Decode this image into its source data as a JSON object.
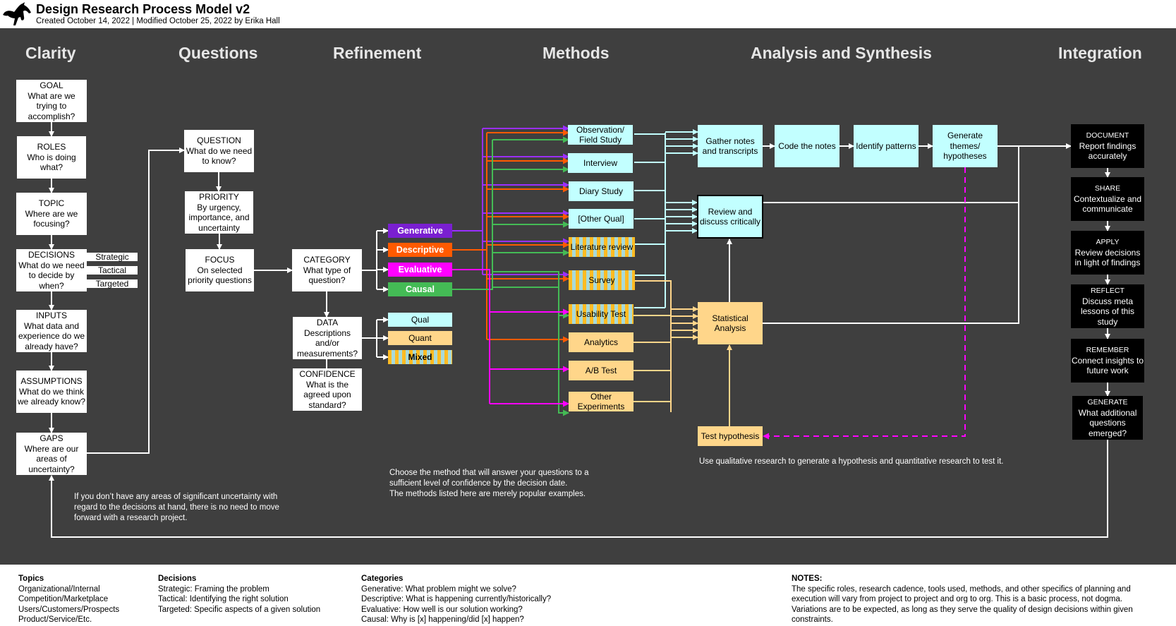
{
  "header": {
    "title": "Design Research Process Model v2",
    "subtitle": "Created October 14, 2022 | Modified October 25, 2022 by Erika Hall",
    "logo_icon": "kicking-horse-logo"
  },
  "stages": [
    "Clarity",
    "Questions",
    "Refinement",
    "Methods",
    "Analysis and Synthesis",
    "Integration"
  ],
  "clarity": [
    {
      "label": "GOAL",
      "text": "What are we trying to accomplish?"
    },
    {
      "label": "ROLES",
      "text": "Who is doing what?"
    },
    {
      "label": "TOPIC",
      "text": "Where are we focusing?"
    },
    {
      "label": "DECISIONS",
      "text": "What do we need to decide by when?"
    },
    {
      "label": "INPUTS",
      "text": "What data and experience do we already have?"
    },
    {
      "label": "ASSUMPTIONS",
      "text": "What do we think we already know?"
    },
    {
      "label": "GAPS",
      "text": "Where are our areas of uncertainty?"
    }
  ],
  "decision_tags": [
    "Strategic",
    "Tactical",
    "Targeted"
  ],
  "questions": [
    {
      "label": "QUESTION",
      "text": "What do we need to know?"
    },
    {
      "label": "PRIORITY",
      "text": "By urgency, importance, and uncertainty"
    },
    {
      "label": "FOCUS",
      "text": "On selected priority questions"
    }
  ],
  "refinement": [
    {
      "label": "CATEGORY",
      "text": "What type of question?"
    },
    {
      "label": "DATA",
      "text": "Descriptions and/or measurements?"
    },
    {
      "label": "CONFIDENCE",
      "text": "What is the agreed upon standard?"
    }
  ],
  "categories": [
    {
      "label": "Generative",
      "color": "#7a1fd1"
    },
    {
      "label": "Descriptive",
      "color": "#ff5a00"
    },
    {
      "label": "Evaluative",
      "color": "#ff00ff"
    },
    {
      "label": "Causal",
      "color": "#44bb55"
    }
  ],
  "data_types": [
    {
      "label": "Qual",
      "style": "cyan"
    },
    {
      "label": "Quant",
      "style": "peach"
    },
    {
      "label": "Mixed",
      "style": "stripe"
    }
  ],
  "methods": [
    {
      "label": "Observation/ Field Study",
      "style": "cyan"
    },
    {
      "label": "Interview",
      "style": "cyan"
    },
    {
      "label": "Diary Study",
      "style": "cyan"
    },
    {
      "label": "[Other Qual]",
      "style": "cyan"
    },
    {
      "label": "Literature review",
      "style": "stripe"
    },
    {
      "label": "Survey",
      "style": "stripe"
    },
    {
      "label": "Usability Test",
      "style": "stripe"
    },
    {
      "label": "Analytics",
      "style": "peach"
    },
    {
      "label": "A/B Test",
      "style": "peach"
    },
    {
      "label": "Other Experiments",
      "style": "peach"
    }
  ],
  "analysis": {
    "gather": "Gather notes and transcripts",
    "code": "Code the notes",
    "identify": "Identify patterns",
    "generate": "Generate themes/ hypotheses",
    "review": "Review and discuss critically",
    "statistical": "Statistical Analysis",
    "test": "Test hypothesis"
  },
  "integration": [
    {
      "label": "DOCUMENT",
      "text": "Report findings accurately"
    },
    {
      "label": "SHARE",
      "text": "Contextualize and communicate"
    },
    {
      "label": "APPLY",
      "text": "Review decisions in light of findings"
    },
    {
      "label": "REFLECT",
      "text": "Discuss meta lessons of this study"
    },
    {
      "label": "REMEMBER",
      "text": "Connect insights to future work"
    },
    {
      "label": "GENERATE",
      "text": "What additional questions emerged?"
    }
  ],
  "notes": {
    "gaps_note": "If you don’t have any areas of significant uncertainty with regard to the decisions at hand, there is no need to move forward with a research project.",
    "methods_note_1": "Choose the method that will answer your questions to a",
    "methods_note_2": "sufficient level of confidence by the decision date.",
    "methods_note_3": "The methods listed here are merely popular examples.",
    "hypothesis_note": "Use qualitative research to generate a hypothesis and quantitative research to test it."
  },
  "legend": {
    "topics": {
      "title": "Topics",
      "items": [
        "Organizational/Internal",
        "Competition/Marketplace",
        "Users/Customers/Prospects",
        "Product/Service/Etc."
      ]
    },
    "decisions": {
      "title": "Decisions",
      "items": [
        "Strategic: Framing the problem",
        "Tactical: Identifying the right solution",
        "Targeted: Specific aspects of a given solution"
      ]
    },
    "categories": {
      "title": "Categories",
      "items": [
        "Generative: What problem might we solve?",
        "Descriptive: What is happening currently/historically?",
        "Evaluative: How well is our solution working?",
        "Causal: Why is [x] happening/did [x] happen?"
      ]
    },
    "notes": {
      "title": "NOTES:",
      "text": "The specific roles, research cadence, tools used, methods, and other specifics of planning and execution will vary from project to project and org to org. This is a basic process, not dogma. Variations are to be expected, as long as they serve the quality of design decisions within given constraints."
    }
  },
  "colors": {
    "background": "#3f3f3f",
    "qual": "#c2ffff",
    "quant": "#ffd68a",
    "generative": "#7a1fd1",
    "descriptive": "#ff5a00",
    "evaluative": "#ff00ff",
    "causal": "#44bb55"
  }
}
